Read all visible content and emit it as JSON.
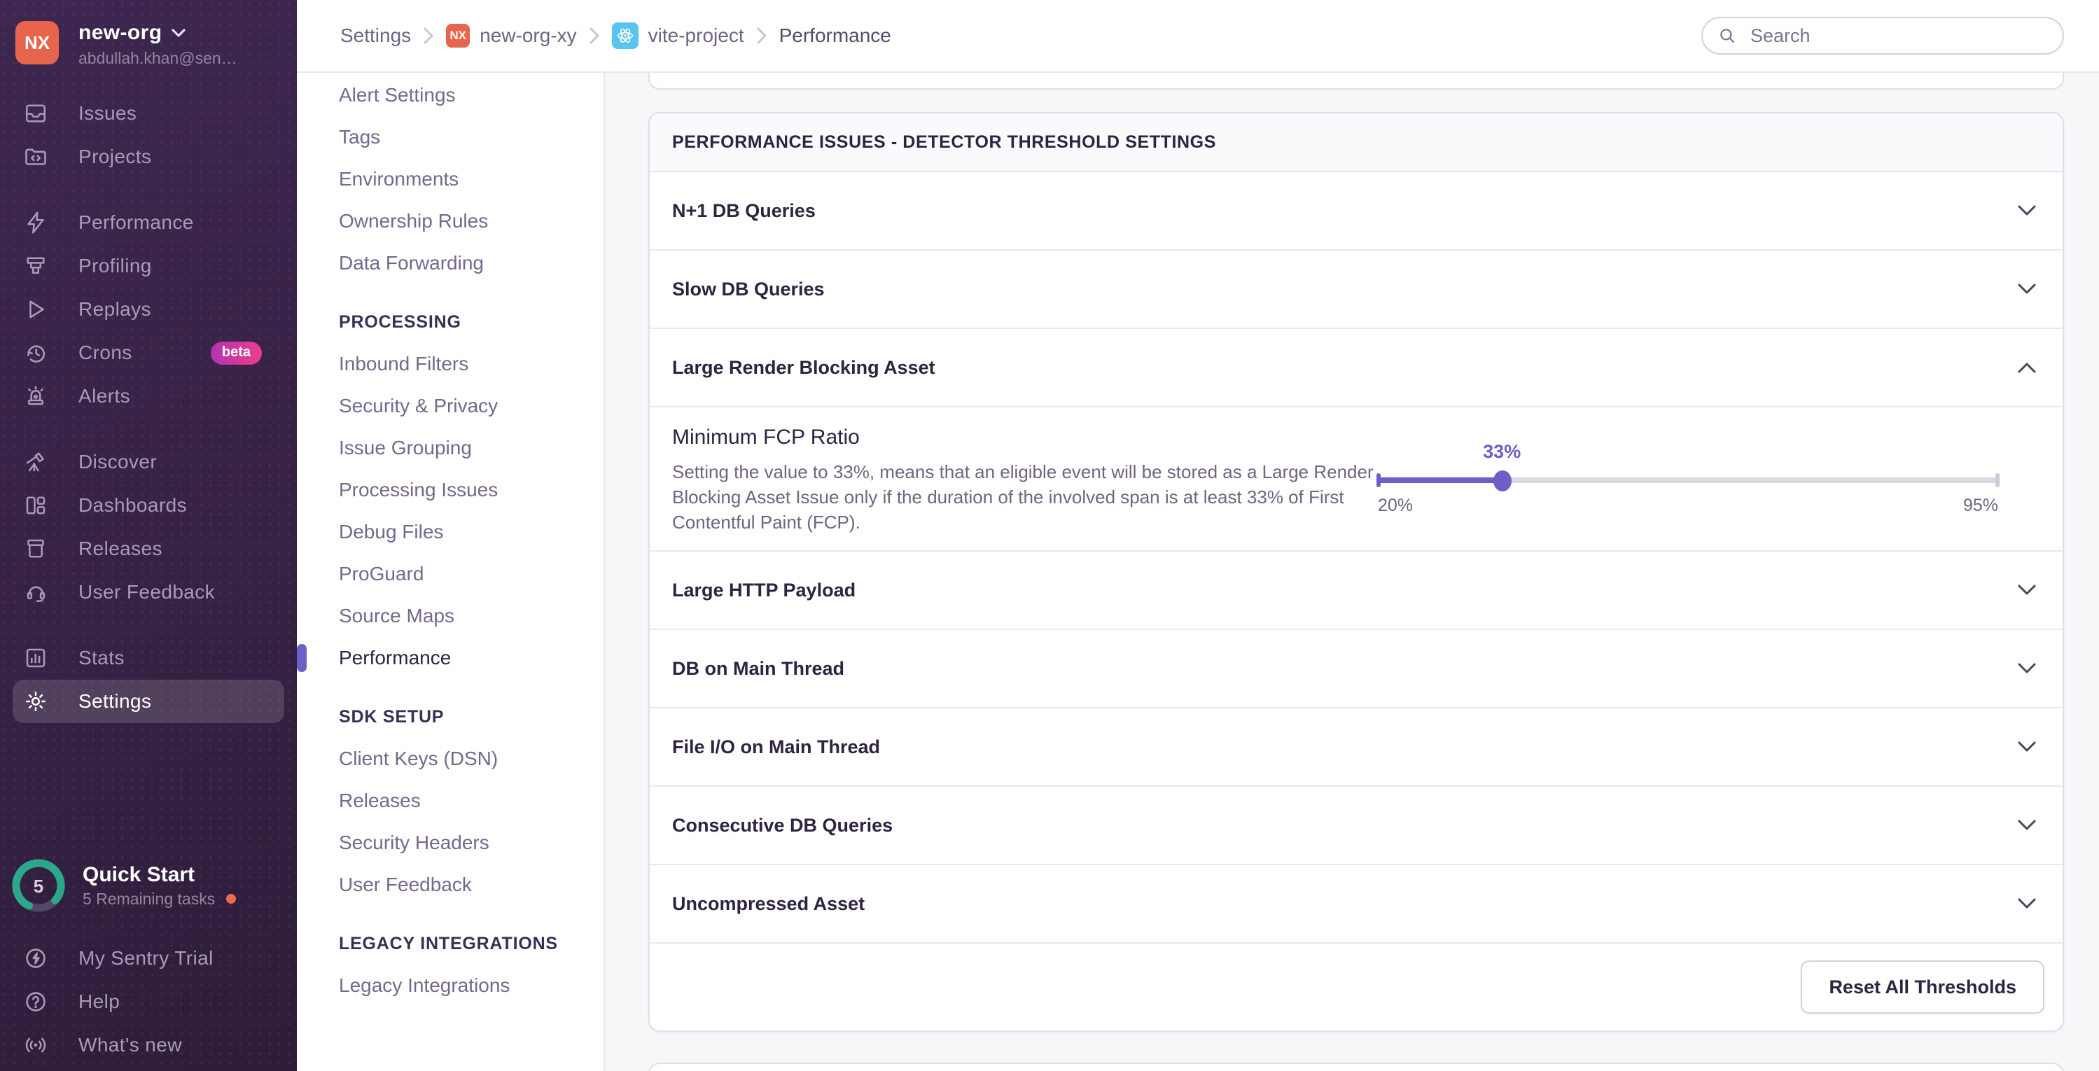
{
  "org_switcher": {
    "initials": "NX",
    "name": "new-org",
    "email": "abdullah.khan@sen…"
  },
  "sidebar": {
    "items": [
      {
        "label": "Issues",
        "icon": "issues-icon"
      },
      {
        "label": "Projects",
        "icon": "projects-icon"
      },
      {
        "label": "Performance",
        "icon": "performance-icon"
      },
      {
        "label": "Profiling",
        "icon": "profiling-icon"
      },
      {
        "label": "Replays",
        "icon": "replays-icon"
      },
      {
        "label": "Crons",
        "icon": "crons-icon",
        "badge": "beta"
      },
      {
        "label": "Alerts",
        "icon": "alerts-icon"
      },
      {
        "label": "Discover",
        "icon": "discover-icon"
      },
      {
        "label": "Dashboards",
        "icon": "dashboards-icon"
      },
      {
        "label": "Releases",
        "icon": "releases-icon"
      },
      {
        "label": "User Feedback",
        "icon": "user-feedback-icon"
      },
      {
        "label": "Stats",
        "icon": "stats-icon"
      },
      {
        "label": "Settings",
        "icon": "gear-icon",
        "active": true
      }
    ]
  },
  "quick_start": {
    "count": "5",
    "title": "Quick Start",
    "subtitle": "5 Remaining tasks"
  },
  "sidebar_footer": {
    "items": [
      {
        "label": "My Sentry Trial",
        "icon": "trial-icon"
      },
      {
        "label": "Help",
        "icon": "help-icon"
      },
      {
        "label": "What's new",
        "icon": "broadcast-icon"
      }
    ]
  },
  "breadcrumb": {
    "items": [
      {
        "label": "Settings"
      },
      {
        "label": "new-org-xy",
        "avatar": "NX"
      },
      {
        "label": "vite-project",
        "avatar": "react-logo"
      },
      {
        "label": "Performance",
        "current": true
      }
    ]
  },
  "search": {
    "placeholder": "Search"
  },
  "settings_nav": {
    "headings": {
      "processing": "PROCESSING",
      "sdk_setup": "SDK SETUP",
      "legacy": "LEGACY INTEGRATIONS"
    },
    "items": [
      {
        "label": "Alert Settings"
      },
      {
        "label": "Tags"
      },
      {
        "label": "Environments"
      },
      {
        "label": "Ownership Rules"
      },
      {
        "label": "Data Forwarding"
      },
      {
        "label": "Inbound Filters"
      },
      {
        "label": "Security & Privacy"
      },
      {
        "label": "Issue Grouping"
      },
      {
        "label": "Processing Issues"
      },
      {
        "label": "Debug Files"
      },
      {
        "label": "ProGuard"
      },
      {
        "label": "Source Maps"
      },
      {
        "label": "Performance",
        "active": true
      },
      {
        "label": "Client Keys (DSN)"
      },
      {
        "label": "Releases"
      },
      {
        "label": "Security Headers"
      },
      {
        "label": "User Feedback"
      },
      {
        "label": "Legacy Integrations"
      }
    ]
  },
  "main": {
    "card_header": "PERFORMANCE ISSUES - DETECTOR THRESHOLD SETTINGS",
    "rows": [
      {
        "label": "N+1 DB Queries",
        "state": "collapsed"
      },
      {
        "label": "Slow DB Queries",
        "state": "collapsed"
      },
      {
        "label": "Large Render Blocking Asset",
        "state": "expanded"
      },
      {
        "label": "Large HTTP Payload",
        "state": "collapsed"
      },
      {
        "label": "DB on Main Thread",
        "state": "collapsed"
      },
      {
        "label": "File I/O on Main Thread",
        "state": "collapsed"
      },
      {
        "label": "Consecutive DB Queries",
        "state": "collapsed"
      },
      {
        "label": "Uncompressed Asset",
        "state": "collapsed"
      }
    ],
    "panel": {
      "title": "Minimum FCP Ratio",
      "description": "Setting the value to 33%, means that an eligible event will be stored as a Large Render Blocking Asset Issue only if the duration of the involved span is at least 33% of First Contentful Paint (FCP).",
      "slider": {
        "value_label": "33%",
        "min_label": "20%",
        "max_label": "95%",
        "percent": 20
      }
    },
    "reset_button": "Reset All Thresholds"
  },
  "colors": {
    "accent": "#6C5FC7",
    "sidebar_bg": "#362244",
    "org_avatar": "#E8654D",
    "project_avatar": "#58C5EE",
    "beta_badge_start": "#B233B2",
    "beta_badge_end": "#EC3E88",
    "progress_ring": "#2BA78A",
    "notification_dot": "#EE6A4E"
  }
}
